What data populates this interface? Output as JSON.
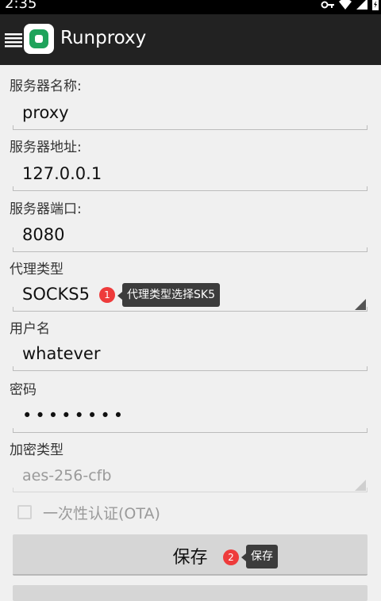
{
  "status_bar": {
    "time": "2:35"
  },
  "app_bar": {
    "title": "Runproxy"
  },
  "form": {
    "server_name_label": "服务器名称:",
    "server_name_value": "proxy",
    "server_addr_label": "服务器地址:",
    "server_addr_value": "127.0.0.1",
    "server_port_label": "服务器端口:",
    "server_port_value": "8080",
    "proxy_type_label": "代理类型",
    "proxy_type_value": "SOCKS5",
    "username_label": "用户名",
    "username_value": "whatever",
    "password_label": "密码",
    "password_value": "••••••••",
    "cipher_label": "加密类型",
    "cipher_value": "aes-256-cfb",
    "ota_label": "一次性认证(OTA)",
    "ota_checked": false
  },
  "annotations": [
    {
      "number": "1",
      "text": "代理类型选择SK5"
    },
    {
      "number": "2",
      "text": "保存"
    }
  ],
  "buttons": {
    "save_label": "保存"
  }
}
